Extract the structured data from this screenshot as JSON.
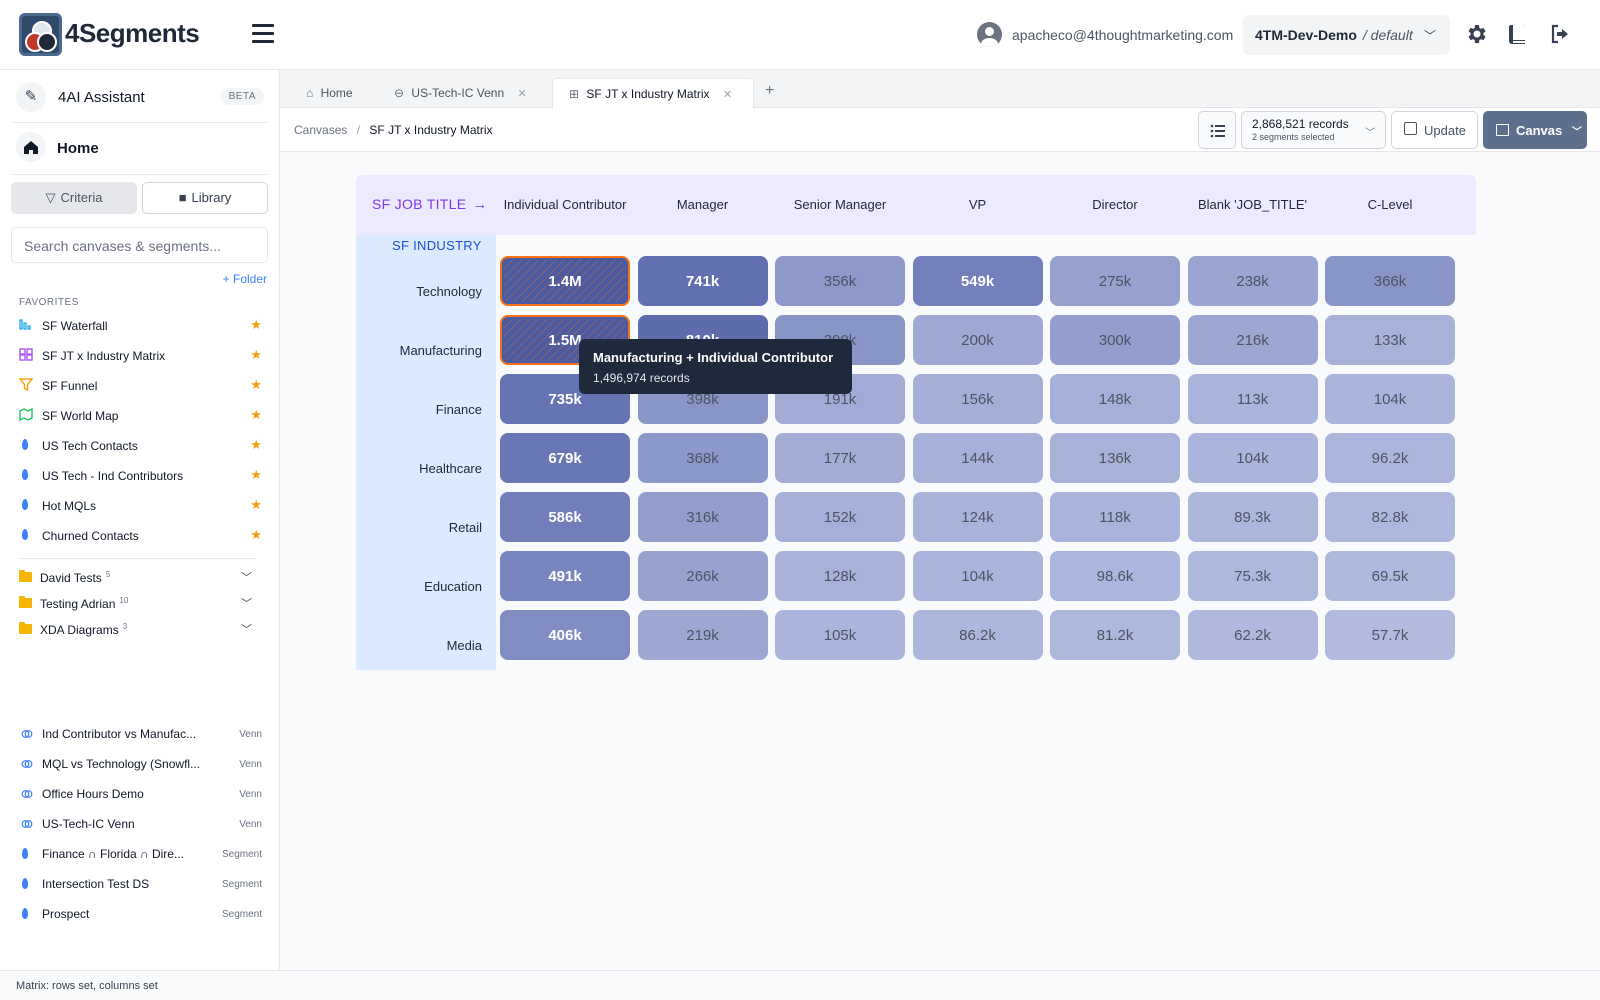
{
  "app": {
    "name": "4Segments"
  },
  "header": {
    "user_email": "apacheco@4thoughtmarketing.com",
    "org": "4TM-Dev-Demo",
    "env": "/ default"
  },
  "sidebar": {
    "assistant": {
      "label": "4AI Assistant",
      "badge": "BETA"
    },
    "home": "Home",
    "criteria": "Criteria",
    "library": "Library",
    "search_placeholder": "Search canvases & segments...",
    "add_folder": "+ Folder",
    "favorites_heading": "FAVORITES",
    "favorites": [
      {
        "label": "SF Waterfall",
        "icon": "waterfall-icon",
        "color": "#0ea5e9"
      },
      {
        "label": "SF JT x Industry Matrix",
        "icon": "matrix-icon",
        "color": "#a855f7"
      },
      {
        "label": "SF Funnel",
        "icon": "funnel-icon",
        "color": "#f59e0b"
      },
      {
        "label": "SF World Map",
        "icon": "map-icon",
        "color": "#22c55e"
      },
      {
        "label": "US Tech Contacts",
        "icon": "segment-icon",
        "color": "#3b82f6"
      },
      {
        "label": "US Tech - Ind Contributors",
        "icon": "segment-icon",
        "color": "#3b82f6"
      },
      {
        "label": "Hot MQLs",
        "icon": "segment-icon",
        "color": "#3b82f6"
      },
      {
        "label": "Churned Contacts",
        "icon": "segment-icon",
        "color": "#3b82f6"
      }
    ],
    "folders": [
      {
        "label": "David Tests",
        "count": "5"
      },
      {
        "label": "Testing Adrian",
        "count": "10"
      },
      {
        "label": "XDA Diagrams",
        "count": "3"
      }
    ],
    "items": [
      {
        "label": "Ind Contributor vs Manufac...",
        "type": "Venn",
        "icon": "venn-icon"
      },
      {
        "label": "MQL vs Technology (Snowfl...",
        "type": "Venn",
        "icon": "venn-icon"
      },
      {
        "label": "Office Hours Demo",
        "type": "Venn",
        "icon": "venn-icon"
      },
      {
        "label": "US-Tech-IC Venn",
        "type": "Venn",
        "icon": "venn-icon"
      },
      {
        "label": "Finance ∩ Florida ∩ Dire...",
        "type": "Segment",
        "icon": "segment-icon"
      },
      {
        "label": "Intersection Test DS",
        "type": "Segment",
        "icon": "segment-icon"
      },
      {
        "label": "Prospect",
        "type": "Segment",
        "icon": "segment-icon"
      }
    ]
  },
  "tabs": [
    {
      "label": "Home",
      "icon": "home-icon"
    },
    {
      "label": "US-Tech-IC Venn",
      "icon": "venn-icon"
    },
    {
      "label": "SF JT x Industry Matrix",
      "icon": "matrix-icon"
    }
  ],
  "toolbar": {
    "breadcrumb_root": "Canvases",
    "breadcrumb_sep": "/",
    "breadcrumb_current": "SF JT x Industry Matrix",
    "records": "2,868,521 records",
    "segments_selected": "2 segments selected",
    "update_label": "Update",
    "canvas_label": "Canvas"
  },
  "matrix": {
    "col_axis_label": "SF JOB TITLE",
    "row_axis_label": "SF INDUSTRY",
    "columns": [
      "Individual Contributor",
      "Manager",
      "Senior Manager",
      "VP",
      "Director",
      "Blank 'JOB_TITLE'",
      "C-Level"
    ],
    "rows": [
      {
        "label": "Technology",
        "cells": [
          "1.4M",
          "741k",
          "356k",
          "549k",
          "275k",
          "238k",
          "366k"
        ],
        "intensity": [
          1.0,
          0.78,
          0.38,
          0.62,
          0.3,
          0.26,
          0.42
        ]
      },
      {
        "label": "Manufacturing",
        "cells": [
          "1.5M",
          "810k",
          "390k",
          "200k",
          "300k",
          "216k",
          "133k"
        ],
        "intensity": [
          1.0,
          0.82,
          0.42,
          0.22,
          0.33,
          0.24,
          0.14
        ]
      },
      {
        "label": "Finance",
        "cells": [
          "735k",
          "398k",
          "191k",
          "156k",
          "148k",
          "113k",
          "104k"
        ],
        "intensity": [
          0.75,
          0.42,
          0.2,
          0.17,
          0.16,
          0.12,
          0.11
        ]
      },
      {
        "label": "Healthcare",
        "cells": [
          "679k",
          "368k",
          "177k",
          "144k",
          "136k",
          "104k",
          "96.2k"
        ],
        "intensity": [
          0.71,
          0.39,
          0.19,
          0.15,
          0.14,
          0.11,
          0.1
        ]
      },
      {
        "label": "Retail",
        "cells": [
          "586k",
          "316k",
          "152k",
          "124k",
          "118k",
          "89.3k",
          "82.8k"
        ],
        "intensity": [
          0.64,
          0.34,
          0.16,
          0.13,
          0.12,
          0.09,
          0.08
        ]
      },
      {
        "label": "Education",
        "cells": [
          "491k",
          "266k",
          "128k",
          "104k",
          "98.6k",
          "75.3k",
          "69.5k"
        ],
        "intensity": [
          0.57,
          0.29,
          0.14,
          0.11,
          0.1,
          0.08,
          0.07
        ]
      },
      {
        "label": "Media",
        "cells": [
          "406k",
          "219k",
          "105k",
          "86.2k",
          "81.2k",
          "62.2k",
          "57.7k"
        ],
        "intensity": [
          0.5,
          0.24,
          0.11,
          0.09,
          0.08,
          0.06,
          0.05
        ]
      }
    ],
    "selected": [
      [
        0,
        0
      ],
      [
        1,
        0
      ]
    ]
  },
  "tooltip": {
    "title": "Manufacturing + Individual Contributor",
    "detail": "1,496,974 records"
  },
  "status": "Matrix: rows set, columns set"
}
